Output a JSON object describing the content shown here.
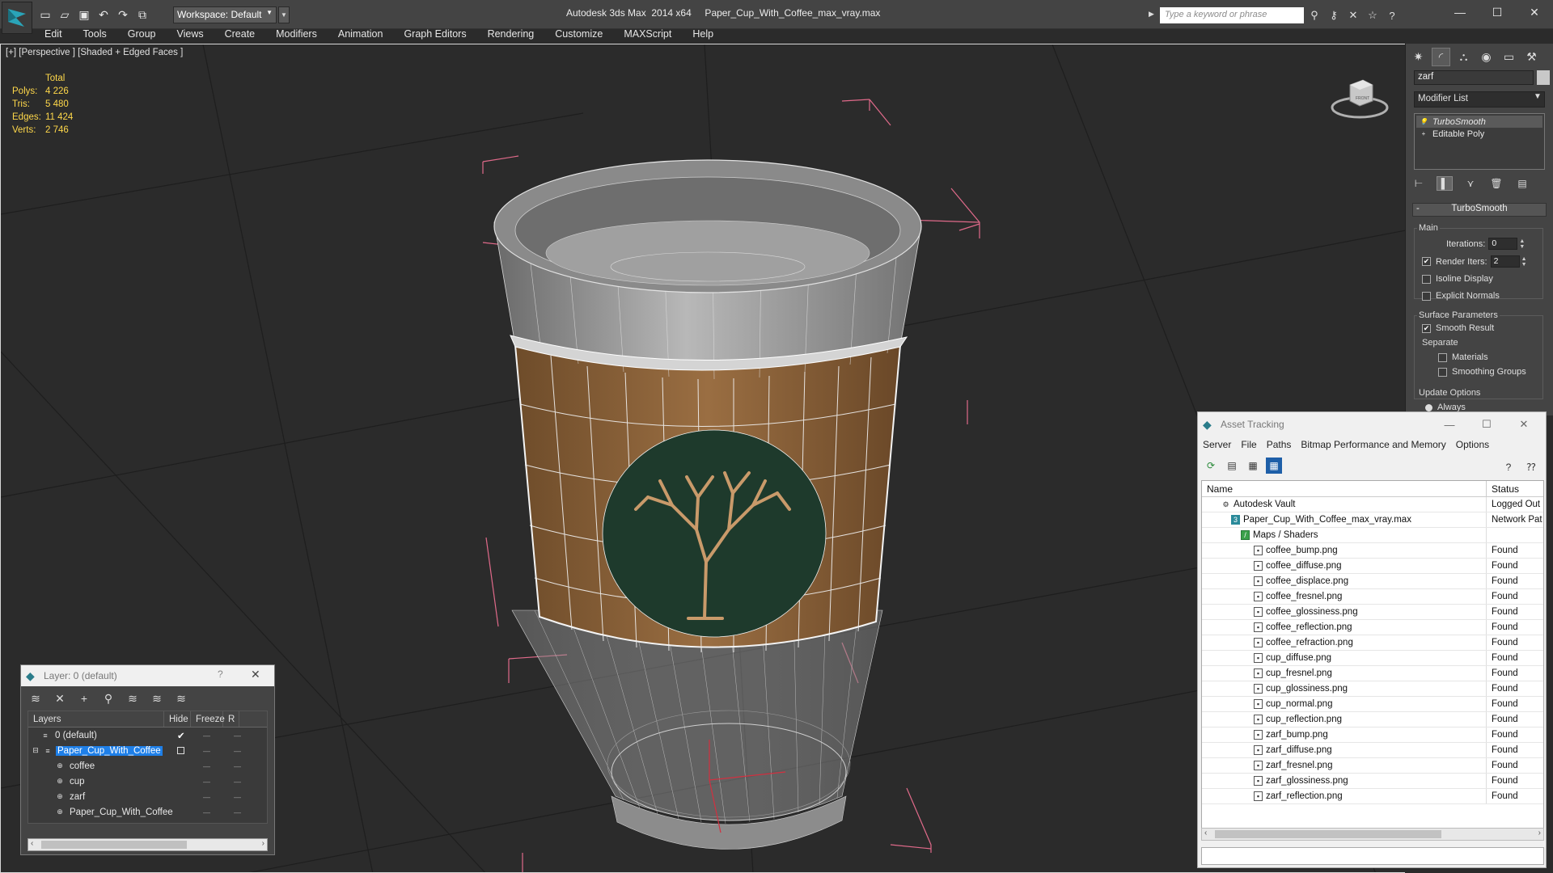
{
  "window": {
    "app_title": "Autodesk 3ds Max  2014 x64     Paper_Cup_With_Coffee_max_vray.max",
    "workspace": "Workspace: Default",
    "search_placeholder": "Type a keyword or phrase"
  },
  "menu": [
    "Edit",
    "Tools",
    "Group",
    "Views",
    "Create",
    "Modifiers",
    "Animation",
    "Graph Editors",
    "Rendering",
    "Customize",
    "MAXScript",
    "Help"
  ],
  "viewport": {
    "label": "[+] [Perspective ] [Shaded + Edged Faces ]",
    "stats": {
      "header": "Total",
      "rows": [
        {
          "key": "Polys:",
          "value": "4 226"
        },
        {
          "key": "Tris:",
          "value": "5 480"
        },
        {
          "key": "Edges:",
          "value": "11 424"
        },
        {
          "key": "Verts:",
          "value": "2 746"
        }
      ]
    },
    "viewcube_label": "FRONT"
  },
  "command_panel": {
    "object_name": "zarf",
    "modifier_list": "Modifier List",
    "stack": [
      "TurboSmooth",
      "Editable Poly"
    ],
    "rollout_title": "TurboSmooth",
    "main_group": "Main",
    "iterations_label": "Iterations:",
    "iterations_value": "0",
    "render_iters_label": "Render Iters:",
    "render_iters_value": "2",
    "isoline": "Isoline Display",
    "explicit_normals": "Explicit Normals",
    "surface_group": "Surface Parameters",
    "smooth_result": "Smooth Result",
    "separate": "Separate",
    "materials": "Materials",
    "smoothing_groups": "Smoothing Groups",
    "update_group": "Update Options",
    "always": "Always"
  },
  "layer_dialog": {
    "title": "Layer: 0 (default)",
    "help": "?",
    "columns": [
      "Layers",
      "Hide",
      "Freeze",
      "R"
    ],
    "rows": [
      {
        "name": "0 (default)"
      },
      {
        "name": "Paper_Cup_With_Coffee"
      },
      {
        "name": "coffee"
      },
      {
        "name": "cup"
      },
      {
        "name": "zarf"
      },
      {
        "name": "Paper_Cup_With_Coffee"
      }
    ]
  },
  "asset_dialog": {
    "title": "Asset Tracking",
    "menu": [
      "Server",
      "File",
      "Paths",
      "Bitmap Performance and Memory",
      "Options"
    ],
    "columns": [
      "Name",
      "Status"
    ],
    "rows": [
      {
        "name": "Autodesk Vault",
        "status": "Logged Out"
      },
      {
        "name": "Paper_Cup_With_Coffee_max_vray.max",
        "status": "Network Pat"
      },
      {
        "name": "Maps / Shaders",
        "status": ""
      },
      {
        "name": "coffee_bump.png",
        "status": "Found"
      },
      {
        "name": "coffee_diffuse.png",
        "status": "Found"
      },
      {
        "name": "coffee_displace.png",
        "status": "Found"
      },
      {
        "name": "coffee_fresnel.png",
        "status": "Found"
      },
      {
        "name": "coffee_glossiness.png",
        "status": "Found"
      },
      {
        "name": "coffee_reflection.png",
        "status": "Found"
      },
      {
        "name": "coffee_refraction.png",
        "status": "Found"
      },
      {
        "name": "cup_diffuse.png",
        "status": "Found"
      },
      {
        "name": "cup_fresnel.png",
        "status": "Found"
      },
      {
        "name": "cup_glossiness.png",
        "status": "Found"
      },
      {
        "name": "cup_normal.png",
        "status": "Found"
      },
      {
        "name": "cup_reflection.png",
        "status": "Found"
      },
      {
        "name": "zarf_bump.png",
        "status": "Found"
      },
      {
        "name": "zarf_diffuse.png",
        "status": "Found"
      },
      {
        "name": "zarf_fresnel.png",
        "status": "Found"
      },
      {
        "name": "zarf_glossiness.png",
        "status": "Found"
      },
      {
        "name": "zarf_reflection.png",
        "status": "Found"
      }
    ]
  },
  "colors": {
    "ui_dark": "#444444",
    "viewport_bg": "#2b2b2b",
    "stats_yellow": "#ffd84a",
    "selection_blue": "#1e7fe8",
    "sleeve_brown": "#8a6238",
    "logo_green": "#1e3a2c",
    "bbox_pink": "#e06a8a"
  }
}
